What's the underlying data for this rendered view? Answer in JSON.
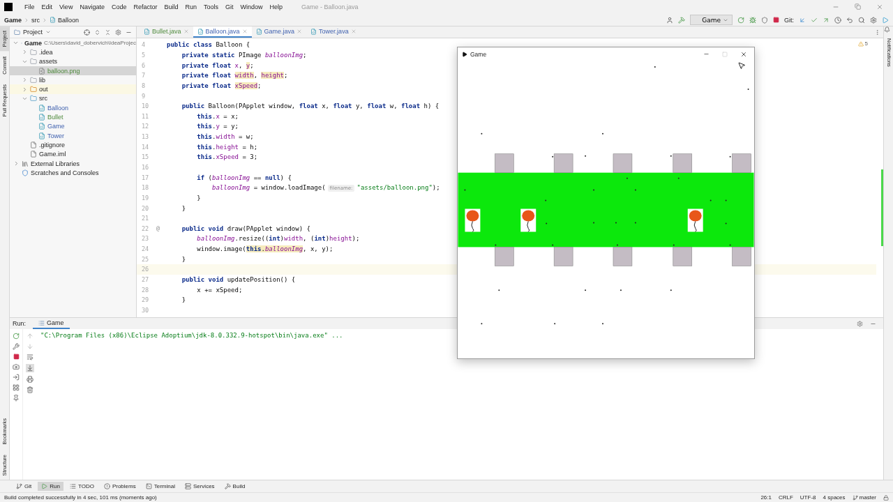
{
  "window": {
    "title": "Game - Balloon.java"
  },
  "menu": [
    "File",
    "Edit",
    "View",
    "Navigate",
    "Code",
    "Refactor",
    "Build",
    "Run",
    "Tools",
    "Git",
    "Window",
    "Help"
  ],
  "breadcrumbs": [
    "Game",
    "src",
    "Balloon"
  ],
  "toolbar": {
    "run_config": "Game",
    "git_label": "Git:"
  },
  "left_strip_top": [
    {
      "label": "Project",
      "selected": true
    },
    {
      "label": "Commit",
      "selected": false
    },
    {
      "label": "Pull Requests",
      "selected": false
    }
  ],
  "left_strip_bottom": [
    "Bookmarks",
    "Structure"
  ],
  "right_strip": [
    "Notifications"
  ],
  "project_panel": {
    "title": "Project",
    "tree": [
      {
        "label": "Game",
        "path": "C:\\Users\\david_dobervich\\IdeaProjec",
        "kind": "module",
        "expanded": true,
        "selected": false,
        "added": false,
        "modified": false,
        "children": [
          {
            "label": ".idea",
            "kind": "folder",
            "expanded": false,
            "selected": false,
            "added": false,
            "modified": false
          },
          {
            "label": "assets",
            "kind": "folder",
            "expanded": true,
            "selected": false,
            "added": false,
            "modified": false,
            "children": [
              {
                "label": "balloon.png",
                "kind": "image",
                "selected": true,
                "added": true,
                "modified": false
              }
            ]
          },
          {
            "label": "lib",
            "kind": "folder",
            "expanded": false,
            "selected": false,
            "added": false,
            "modified": false
          },
          {
            "label": "out",
            "kind": "excluded",
            "expanded": false,
            "selected": false,
            "added": false,
            "modified": false
          },
          {
            "label": "src",
            "kind": "source",
            "expanded": true,
            "selected": false,
            "added": false,
            "modified": false,
            "children": [
              {
                "label": "Balloon",
                "kind": "class",
                "selected": false,
                "added": false,
                "modified": true
              },
              {
                "label": "Bullet",
                "kind": "class",
                "selected": false,
                "added": true,
                "modified": false
              },
              {
                "label": "Game",
                "kind": "class",
                "selected": false,
                "added": false,
                "modified": true
              },
              {
                "label": "Tower",
                "kind": "class",
                "selected": false,
                "added": false,
                "modified": true
              }
            ]
          },
          {
            "label": ".gitignore",
            "kind": "file",
            "selected": false,
            "added": false,
            "modified": false
          },
          {
            "label": "Game.iml",
            "kind": "file",
            "selected": false,
            "added": false,
            "modified": false
          }
        ]
      },
      {
        "label": "External Libraries",
        "kind": "library",
        "expanded": false,
        "selected": false,
        "added": false,
        "modified": false
      },
      {
        "label": "Scratches and Consoles",
        "kind": "scratch",
        "selected": false,
        "added": false,
        "modified": false
      }
    ]
  },
  "editor_tabs": [
    {
      "label": "Bullet.java",
      "selected": false,
      "added": true,
      "modified": false
    },
    {
      "label": "Balloon.java",
      "selected": true,
      "added": false,
      "modified": true
    },
    {
      "label": "Game.java",
      "selected": false,
      "added": false,
      "modified": true
    },
    {
      "label": "Tower.java",
      "selected": false,
      "added": false,
      "modified": true
    }
  ],
  "warnings_count": "5",
  "code": [
    {
      "number": "4",
      "current": false,
      "tokens": [
        {
          "text": "public class ",
          "kind": "kw"
        },
        {
          "text": "Balloon {",
          "kind": "plain"
        }
      ]
    },
    {
      "number": "5",
      "current": false,
      "tokens": [
        {
          "text": "    private static ",
          "kind": "kw"
        },
        {
          "text": "PImage ",
          "kind": "plain"
        },
        {
          "text": "balloonImg",
          "kind": "static"
        },
        {
          "text": ";",
          "kind": "plain"
        }
      ]
    },
    {
      "number": "6",
      "current": false,
      "tokens": [
        {
          "text": "    private float ",
          "kind": "kw"
        },
        {
          "text": "x",
          "kind": "field"
        },
        {
          "text": ", ",
          "kind": "plain"
        },
        {
          "text": "y",
          "kind": "field_marked"
        },
        {
          "text": ";",
          "kind": "plain"
        }
      ]
    },
    {
      "number": "7",
      "current": false,
      "tokens": [
        {
          "text": "    private float ",
          "kind": "kw"
        },
        {
          "text": "width",
          "kind": "field_marked"
        },
        {
          "text": ", ",
          "kind": "plain"
        },
        {
          "text": "height",
          "kind": "field_marked"
        },
        {
          "text": ";",
          "kind": "plain"
        }
      ]
    },
    {
      "number": "8",
      "current": false,
      "tokens": [
        {
          "text": "    private float ",
          "kind": "kw"
        },
        {
          "text": "xSpeed",
          "kind": "field_marked"
        },
        {
          "text": ";",
          "kind": "plain"
        }
      ]
    },
    {
      "number": "9",
      "current": false
    },
    {
      "number": "10",
      "current": false,
      "tokens": [
        {
          "text": "    public ",
          "kind": "kw"
        },
        {
          "text": "Balloon(PApplet window, ",
          "kind": "plain"
        },
        {
          "text": "float ",
          "kind": "kw"
        },
        {
          "text": "x, ",
          "kind": "plain"
        },
        {
          "text": "float ",
          "kind": "kw"
        },
        {
          "text": "y, ",
          "kind": "plain"
        },
        {
          "text": "float ",
          "kind": "kw"
        },
        {
          "text": "w, ",
          "kind": "plain"
        },
        {
          "text": "float ",
          "kind": "kw"
        },
        {
          "text": "h) {",
          "kind": "plain"
        }
      ]
    },
    {
      "number": "11",
      "current": false,
      "tokens": [
        {
          "text": "        this",
          "kind": "kw"
        },
        {
          "text": ".",
          "kind": "plain"
        },
        {
          "text": "x",
          "kind": "field"
        },
        {
          "text": " = x;",
          "kind": "plain"
        }
      ]
    },
    {
      "number": "12",
      "current": false,
      "tokens": [
        {
          "text": "        this",
          "kind": "kw"
        },
        {
          "text": ".",
          "kind": "plain"
        },
        {
          "text": "y",
          "kind": "field"
        },
        {
          "text": " = y;",
          "kind": "plain"
        }
      ]
    },
    {
      "number": "13",
      "current": false,
      "tokens": [
        {
          "text": "        this",
          "kind": "kw"
        },
        {
          "text": ".",
          "kind": "plain"
        },
        {
          "text": "width",
          "kind": "field"
        },
        {
          "text": " = w;",
          "kind": "plain"
        }
      ]
    },
    {
      "number": "14",
      "current": false,
      "tokens": [
        {
          "text": "        this",
          "kind": "kw"
        },
        {
          "text": ".",
          "kind": "plain"
        },
        {
          "text": "height",
          "kind": "field"
        },
        {
          "text": " = h;",
          "kind": "plain"
        }
      ]
    },
    {
      "number": "15",
      "current": false,
      "tokens": [
        {
          "text": "        this",
          "kind": "kw"
        },
        {
          "text": ".",
          "kind": "plain"
        },
        {
          "text": "xSpeed",
          "kind": "field"
        },
        {
          "text": " = 3;",
          "kind": "plain"
        }
      ]
    },
    {
      "number": "16",
      "current": false
    },
    {
      "number": "17",
      "current": false,
      "tokens": [
        {
          "text": "        if ",
          "kind": "kw"
        },
        {
          "text": "(",
          "kind": "plain"
        },
        {
          "text": "balloonImg",
          "kind": "static"
        },
        {
          "text": " == ",
          "kind": "plain"
        },
        {
          "text": "null",
          "kind": "kw"
        },
        {
          "text": ") {",
          "kind": "plain"
        }
      ]
    },
    {
      "number": "18",
      "current": false,
      "tokens": [
        {
          "text": "            balloonImg",
          "kind": "static"
        },
        {
          "text": " = window.loadImage(",
          "kind": "plain"
        },
        {
          "text": "filename:",
          "kind": "hint"
        },
        {
          "text": "\"assets/balloon.png\"",
          "kind": "str"
        },
        {
          "text": ");",
          "kind": "plain"
        }
      ]
    },
    {
      "number": "19",
      "current": false,
      "tokens": [
        {
          "text": "        }",
          "kind": "plain"
        }
      ]
    },
    {
      "number": "20",
      "current": false,
      "tokens": [
        {
          "text": "    }",
          "kind": "plain"
        }
      ]
    },
    {
      "number": "21",
      "current": false
    },
    {
      "number": "22",
      "current": false,
      "gutter_mark": "@",
      "tokens": [
        {
          "text": "    public void ",
          "kind": "kw"
        },
        {
          "text": "draw(PApplet window) {",
          "kind": "plain"
        }
      ]
    },
    {
      "number": "23",
      "current": false,
      "tokens": [
        {
          "text": "        balloonImg",
          "kind": "static"
        },
        {
          "text": ".resize((",
          "kind": "plain"
        },
        {
          "text": "int",
          "kind": "kw"
        },
        {
          "text": ")",
          "kind": "plain"
        },
        {
          "text": "width",
          "kind": "field"
        },
        {
          "text": ", (",
          "kind": "plain"
        },
        {
          "text": "int",
          "kind": "kw"
        },
        {
          "text": ")",
          "kind": "plain"
        },
        {
          "text": "height",
          "kind": "field"
        },
        {
          "text": ");",
          "kind": "plain"
        }
      ]
    },
    {
      "number": "24",
      "current": false,
      "tokens": [
        {
          "text": "        window.image(",
          "kind": "plain"
        },
        {
          "text": "this",
          "kind": "kw_marked"
        },
        {
          "text": ".",
          "kind": "plain_marked"
        },
        {
          "text": "balloonImg",
          "kind": "static_marked"
        },
        {
          "text": ", x, y);",
          "kind": "plain"
        }
      ]
    },
    {
      "number": "25",
      "current": false,
      "tokens": [
        {
          "text": "    }",
          "kind": "plain"
        }
      ]
    },
    {
      "number": "26",
      "current": true
    },
    {
      "number": "27",
      "current": false,
      "tokens": [
        {
          "text": "    public void ",
          "kind": "kw"
        },
        {
          "text": "updatePosition() {",
          "kind": "plain"
        }
      ]
    },
    {
      "number": "28",
      "current": false,
      "tokens": [
        {
          "text": "        x += xSpeed;",
          "kind": "plain"
        }
      ]
    },
    {
      "number": "29",
      "current": false,
      "tokens": [
        {
          "text": "    }",
          "kind": "plain"
        }
      ]
    },
    {
      "number": "30",
      "current": false
    }
  ],
  "run_panel": {
    "label": "Run:",
    "tab": "Game",
    "output": "\"C:\\Program Files (x86)\\Eclipse Adoptium\\jdk-8.0.332.9-hotspot\\bin\\java.exe\" ..."
  },
  "tool_tabs": [
    {
      "label": "Git",
      "kind": "git",
      "selected": false
    },
    {
      "label": "Run",
      "kind": "run",
      "selected": true
    },
    {
      "label": "TODO",
      "kind": "todo",
      "selected": false
    },
    {
      "label": "Problems",
      "kind": "problems",
      "selected": false
    },
    {
      "label": "Terminal",
      "kind": "terminal",
      "selected": false
    },
    {
      "label": "Services",
      "kind": "services",
      "selected": false
    },
    {
      "label": "Build",
      "kind": "build",
      "selected": false
    }
  ],
  "status_bar": {
    "message": "Build completed successfully in 4 sec, 101 ms (moments ago)",
    "items": [
      "26:1",
      "CRLF",
      "UTF-8",
      "4 spaces"
    ],
    "branch": "master"
  },
  "game_window": {
    "title": "Game"
  }
}
